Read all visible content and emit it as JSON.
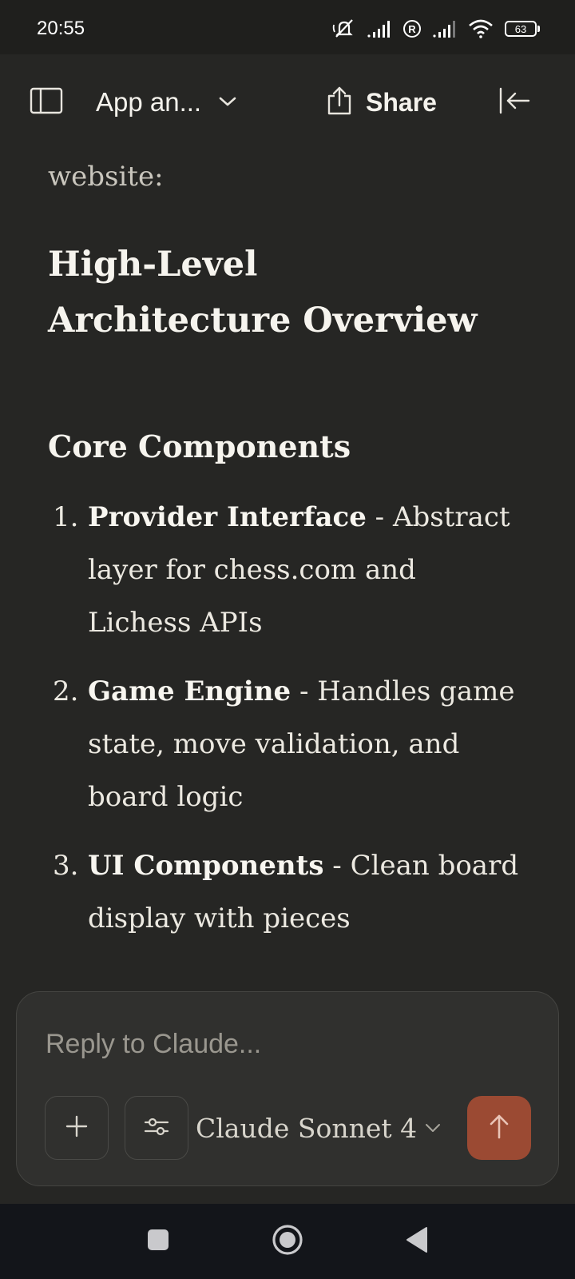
{
  "status_bar": {
    "time": "20:55",
    "battery": "63",
    "icons": [
      "mute-icon",
      "signal-icon",
      "roaming-icon",
      "signal-icon",
      "wifi-icon",
      "battery-icon"
    ]
  },
  "header": {
    "title": "App an...",
    "share_label": "Share",
    "icons": {
      "sidebar": "sidebar-icon",
      "dropdown": "chevron-down-icon",
      "share": "share-icon",
      "collapse": "collapse-left-icon"
    }
  },
  "content": {
    "intro": "website:",
    "heading": "High-Level Architecture Overview",
    "subheading": "Core Components",
    "items": [
      {
        "number": "1.",
        "title": "Provider Interface",
        "text": " - Abstract layer for chess.com and Lichess APIs"
      },
      {
        "number": "2.",
        "title": "Game Engine",
        "text": " - Handles game state, move validation, and board logic"
      },
      {
        "number": "3.",
        "title": "UI Components",
        "text": " - Clean board display with pieces"
      }
    ]
  },
  "composer": {
    "placeholder": "Reply to Claude...",
    "value": "",
    "model": "Claude Sonnet 4",
    "icons": {
      "add": "plus-icon",
      "tools": "sliders-icon",
      "model_dropdown": "chevron-down-icon",
      "send": "arrow-up-icon"
    },
    "send_color": "#9b4a33"
  },
  "nav_bar": {
    "icons": [
      "recents-icon",
      "home-icon",
      "back-icon"
    ]
  }
}
